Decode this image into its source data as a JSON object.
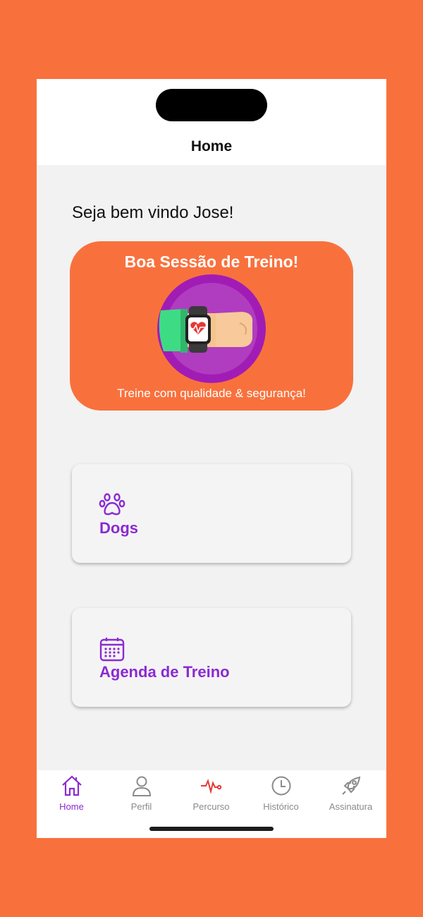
{
  "header": {
    "title": "Home"
  },
  "welcome_text": "Seja bem vindo Jose!",
  "banner": {
    "title": "Boa Sessão de Treino!",
    "subtitle": "Treine com qualidade & segurança!",
    "illustration_icon": "smartwatch-heart-icon",
    "background_color": "#F8713D"
  },
  "cards": [
    {
      "label": "Dogs",
      "icon": "paw-icon"
    },
    {
      "label": "Agenda de Treino",
      "icon": "calendar-icon"
    }
  ],
  "tabbar": {
    "active_index": 0,
    "tabs": [
      {
        "label": "Home",
        "icon": "home-icon"
      },
      {
        "label": "Perfil",
        "icon": "user-icon"
      },
      {
        "label": "Percurso",
        "icon": "heartbeat-icon"
      },
      {
        "label": "Histórico",
        "icon": "clock-icon"
      },
      {
        "label": "Assinatura",
        "icon": "rocket-icon"
      }
    ]
  },
  "colors": {
    "accent": "#8A2BD2",
    "brand_orange": "#F8713D",
    "heartbeat_red": "#E53935",
    "inactive_gray": "#8A8A8E"
  }
}
